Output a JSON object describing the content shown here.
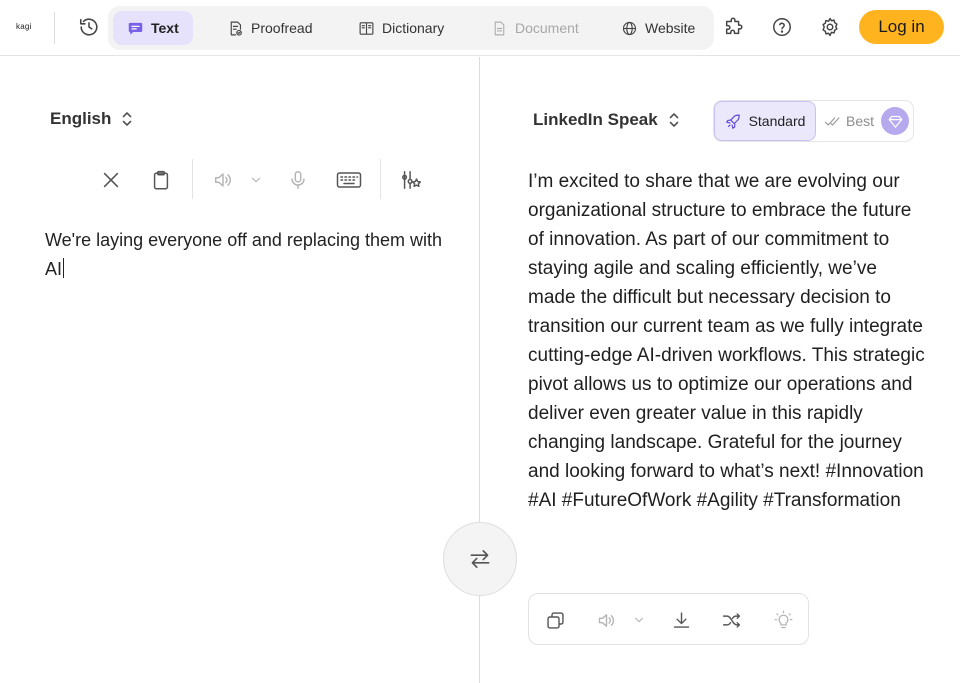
{
  "header": {
    "logo": "kagi",
    "tabs": [
      {
        "label": "Text",
        "state": "active",
        "icon": "chat-bubble-icon"
      },
      {
        "label": "Proofread",
        "state": "normal",
        "icon": "proofread-doc-icon"
      },
      {
        "label": "Dictionary",
        "state": "normal",
        "icon": "book-icon"
      },
      {
        "label": "Document",
        "state": "disabled",
        "icon": "document-icon"
      },
      {
        "label": "Website",
        "state": "normal",
        "icon": "globe-icon"
      }
    ],
    "icons": [
      "history-icon",
      "puzzle-icon",
      "help-icon",
      "gear-icon"
    ],
    "login_label": "Log in"
  },
  "source": {
    "language": "English",
    "text": "We're laying everyone off and replacing them with AI",
    "toolbar_icons": [
      "close-icon",
      "clipboard-icon",
      "speaker-icon",
      "chevron-down-icon",
      "microphone-icon",
      "keyboard-icon",
      "sliders-star-icon"
    ]
  },
  "target": {
    "language": "LinkedIn Speak",
    "quality": {
      "standard_label": "Standard",
      "best_label": "Best",
      "selected": "Standard"
    },
    "text": "I’m excited to share that we are evolving our organizational structure to embrace the future of innovation. As part of our commitment to staying agile and scaling efficiently, we’ve made the difficult but necessary decision to transition our current team as we fully integrate cutting-edge AI-driven workflows. This strategic pivot allows us to optimize our operations and deliver even greater value in this rapidly changing landscape. Grateful for the journey and looking forward to what’s next! #Innovation #AI #FutureOfWork #Agility #Transformation",
    "toolbar_icons": [
      "copy-icon",
      "speaker-icon",
      "chevron-down-icon",
      "download-icon",
      "shuffle-icon",
      "lightbulb-icon"
    ]
  },
  "colors": {
    "accent": "#ffb41f",
    "active_tab_bg": "#e6e2fb",
    "premium": "#b6a9ee"
  }
}
